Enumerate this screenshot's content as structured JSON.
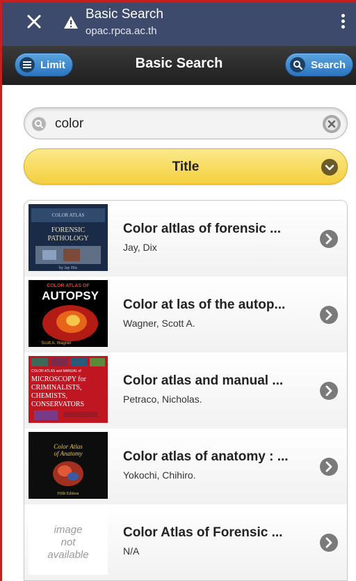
{
  "browser": {
    "page_title": "Basic Search",
    "url": "opac.rpca.ac.th"
  },
  "header": {
    "title": "Basic Search",
    "limit_label": "Limit",
    "search_label": "Search"
  },
  "search": {
    "query": "color"
  },
  "search_type": {
    "selected": "Title"
  },
  "results": [
    {
      "title": "Color altlas of forensic ...",
      "author": "Jay, Dix",
      "cover": {
        "top": "COLOR ATLAS",
        "main": "FORENSIC PATHOLOGY",
        "bottom": "by Jay Dix"
      }
    },
    {
      "title": "Color at las of the autop...",
      "author": "Wagner, Scott A.",
      "cover": {
        "top": "COLOR ATLAS OF",
        "main": "AUTOPSY",
        "bottom": "Scott A. Wagner"
      }
    },
    {
      "title": "Color atlas and manual ...",
      "author": "Petraco, Nicholas.",
      "cover": {
        "top": "COLOR ATLAS and MANUAL of",
        "main": "MICROSCOPY for CRIMINALISTS, CHEMISTS, CONSERVATORS",
        "bottom": ""
      }
    },
    {
      "title": "Color atlas of anatomy : ...",
      "author": "Yokochi, Chihiro.",
      "cover": {
        "top": "",
        "main": "Color Atlas of Anatomy",
        "bottom": "Fifth Edition"
      }
    },
    {
      "title": "Color Atlas of Forensic ...",
      "author": "N/A",
      "cover": {
        "top": "image",
        "main": "not",
        "bottom": "available"
      }
    }
  ],
  "colors": {
    "chrome": "#3d4a6b",
    "appbar": "#1f1f1f",
    "accent_blue": "#2b74bf",
    "select_yellow": "#f4cf3e"
  },
  "icons": {
    "close": "close-icon",
    "warning": "warning-icon",
    "menu": "kebab-menu-icon",
    "limit": "list-icon",
    "search": "search-icon",
    "clear": "clear-icon",
    "dropdown": "chevron-down-icon",
    "row_arrow": "chevron-right-icon"
  }
}
